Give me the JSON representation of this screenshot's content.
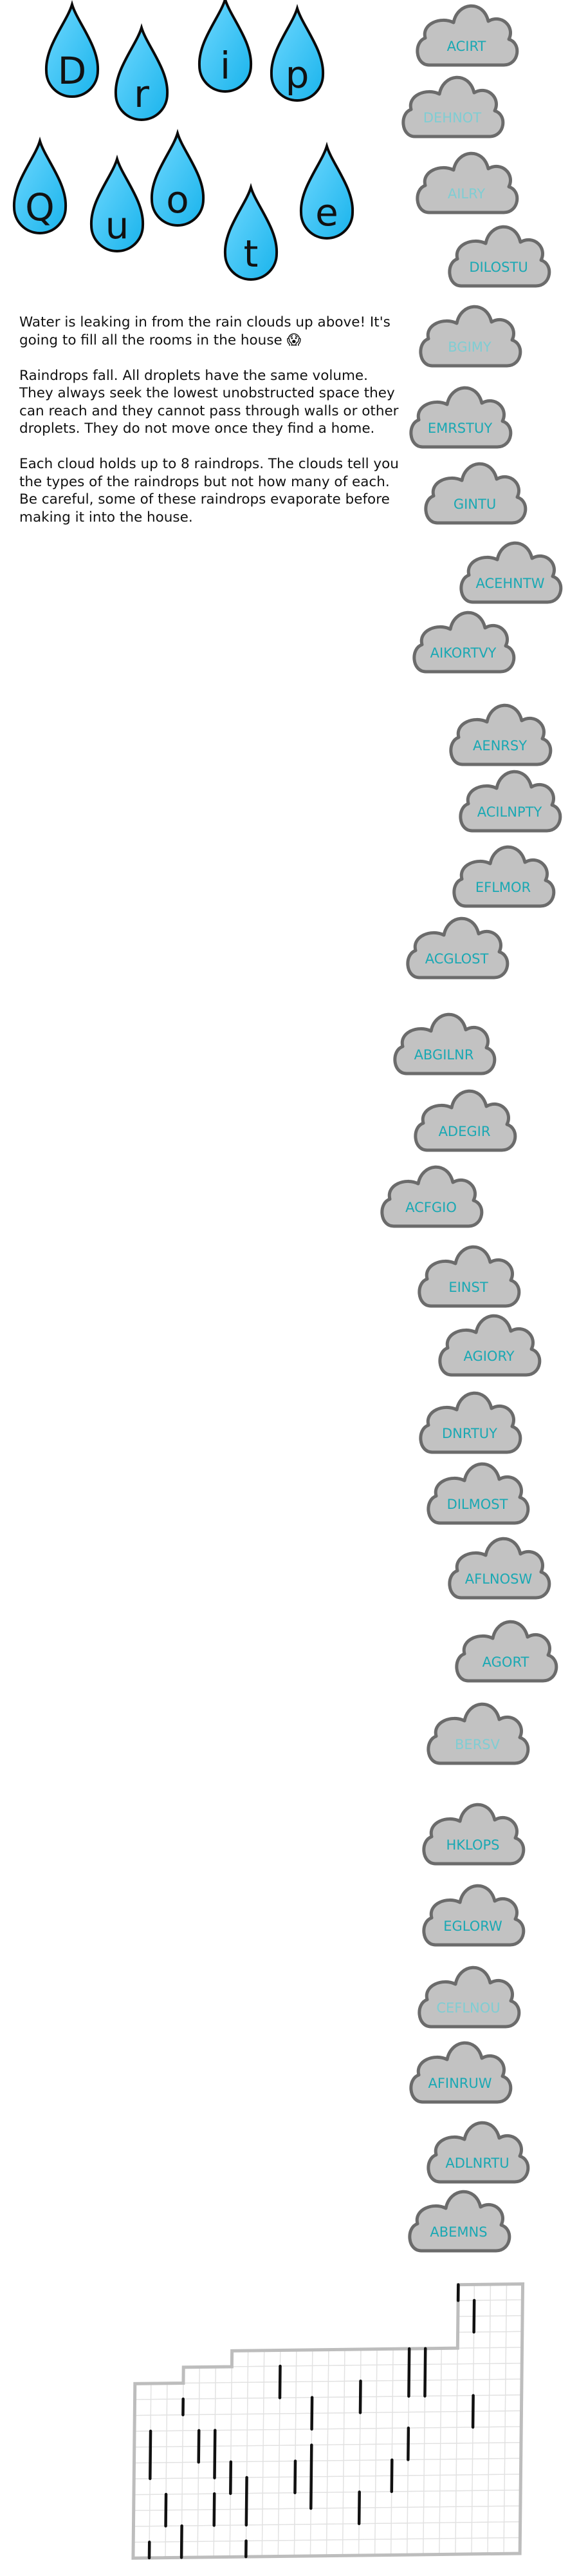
{
  "title": {
    "letters": [
      "D",
      "r",
      "i",
      "p",
      "Q",
      "u",
      "o",
      "t",
      "e"
    ],
    "drop_fill": "#1ab4ec",
    "drop_fill_light": "#6fd8ff",
    "drop_stroke": "#0a0a0a"
  },
  "instructions": [
    "Water is leaking in from the rain clouds up above! It's going to fill all the rooms in the house 😱",
    "Raindrops fall. All droplets have the same volume. They always seek the lowest unobstructed space they can reach and they cannot pass through walls or other droplets. They do not move once they find a home.",
    "Each cloud holds up to 8 raindrops. The clouds tell you the types of the raindrops but not how many of each. Be careful, some of these raindrops evaporate before making it into the house."
  ],
  "cloud_style": {
    "fill": "#c2c2c2",
    "stroke": "#6b6b6b",
    "text_color": "#1aa8b3",
    "text_color_faded": "#7fcdd3"
  },
  "clouds": [
    {
      "label": "ACIRT",
      "faded": false
    },
    {
      "label": "DEHNOT",
      "faded": true
    },
    {
      "label": "AILRY",
      "faded": true
    },
    {
      "label": "DILOSTU",
      "faded": false
    },
    {
      "label": "BGIMY",
      "faded": true
    },
    {
      "label": "EMRSTUY",
      "faded": false
    },
    {
      "label": "GINTU",
      "faded": false
    },
    {
      "label": "ACEHNTW",
      "faded": false
    },
    {
      "label": "AIKORTVY",
      "faded": false
    },
    {
      "label": "AENRSY",
      "faded": false
    },
    {
      "label": "ACILNPTY",
      "faded": false
    },
    {
      "label": "EFLMOR",
      "faded": false
    },
    {
      "label": "ACGLOST",
      "faded": false
    },
    {
      "label": "ABGILNR",
      "faded": false
    },
    {
      "label": "ADEGIR",
      "faded": false
    },
    {
      "label": "ACFGIO",
      "faded": false
    },
    {
      "label": "EINST",
      "faded": false
    },
    {
      "label": "AGIORY",
      "faded": false
    },
    {
      "label": "DNRTUY",
      "faded": false
    },
    {
      "label": "DILMOST",
      "faded": false
    },
    {
      "label": "AFLNOSW",
      "faded": false
    },
    {
      "label": "AGORT",
      "faded": false
    },
    {
      "label": "BERSV",
      "faded": true
    },
    {
      "label": "HKLOPS",
      "faded": false
    },
    {
      "label": "EGLORW",
      "faded": false
    },
    {
      "label": "CEFLNOU",
      "faded": true
    },
    {
      "label": "AFINRUW",
      "faded": false
    },
    {
      "label": "ADLNRTU",
      "faded": false
    },
    {
      "label": "ABEMNS",
      "faded": false
    }
  ],
  "house": {
    "outline_color": "#bdbdbd",
    "grid_color": "#e2e2e2",
    "wall_color": "#111111"
  }
}
